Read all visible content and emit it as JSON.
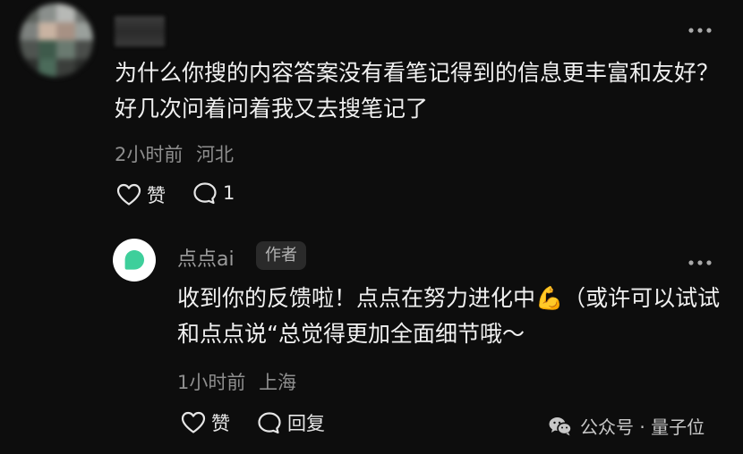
{
  "comment": {
    "username": "",
    "text": "为什么你搜的内容答案没有看笔记得到的信息更丰富和友好？好几次问着问着我又去搜笔记了",
    "time": "2小时前",
    "location": "河北",
    "like_label": "赞",
    "reply_count": "1",
    "more_icon": "more-horizontal-icon"
  },
  "reply": {
    "username": "点点ai",
    "author_badge": "作者",
    "text": "收到你的反馈啦！点点在努力进化中💪（或许可以试试和点点说“总觉得更加全面细节哦～",
    "time": "1小时前",
    "location": "上海",
    "like_label": "赞",
    "reply_label": "回复",
    "more_icon": "more-horizontal-icon",
    "avatar_color": "#3ecf9b"
  },
  "watermark": {
    "text": "公众号 · 量子位",
    "icon": "wechat-icon"
  }
}
